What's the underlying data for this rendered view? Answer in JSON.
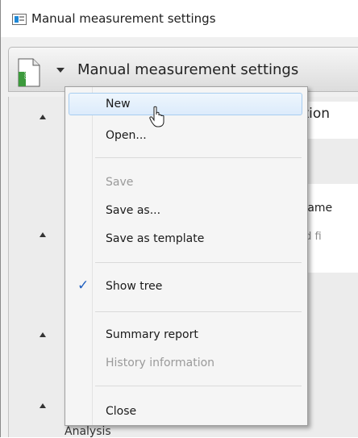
{
  "window": {
    "title": "Manual measurement settings"
  },
  "toolbar": {
    "title": "Manual measurement settings",
    "file_icon": "sdp-document-icon"
  },
  "background": {
    "section_title_partial": "fication",
    "field_label_partial": "ple Name",
    "field_placeholder_partial": "quired fi",
    "bottom_label_partial": "Analysis"
  },
  "menu": {
    "items": [
      {
        "label": "New",
        "enabled": true,
        "highlighted": true
      },
      {
        "label": "Open...",
        "enabled": true
      },
      {
        "label": "Save",
        "enabled": false
      },
      {
        "label": "Save as...",
        "enabled": true
      },
      {
        "label": "Save as template",
        "enabled": true
      },
      {
        "label": "Show tree",
        "enabled": true,
        "checked": true
      },
      {
        "label": "Summary report",
        "enabled": true
      },
      {
        "label": "History information",
        "enabled": false
      },
      {
        "label": "Close",
        "enabled": true
      }
    ],
    "check_icon": "checkmark-icon",
    "check_color": "#1f5fbf",
    "highlight_color": "#dcebfb"
  }
}
